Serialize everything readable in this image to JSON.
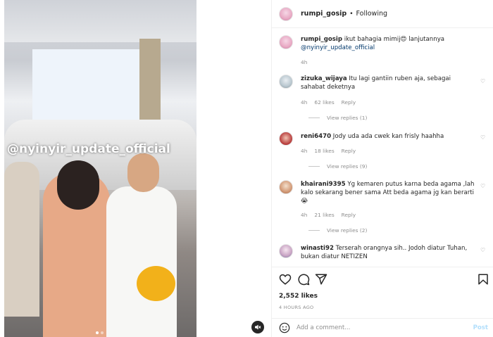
{
  "post": {
    "watermark": "@nyinyir_update_official"
  },
  "header": {
    "username": "rumpi_gosip",
    "separator": "•",
    "follow_label": "Following"
  },
  "caption": {
    "username": "rumpi_gosip",
    "text": "ikut bahagia mimij😍 lanjutannya",
    "mention": "@nyinyir_update_official",
    "time": "4h"
  },
  "comments": [
    {
      "username": "zizuka_wijaya",
      "text": "Itu lagi gantiin ruben aja, sebagai sahabat deketnya",
      "time": "4h",
      "likes": "62 likes",
      "reply": "Reply",
      "view_replies": "View replies (1)"
    },
    {
      "username": "reni6470",
      "text": "Jody uda ada cwek kan frisly haahha",
      "time": "4h",
      "likes": "18 likes",
      "reply": "Reply",
      "view_replies": "View replies (9)"
    },
    {
      "username": "khairani9395",
      "text": "Yg kemaren putus karna beda agama ,lah kalo sekarang bener sama Att beda agama jg kan berarti 😭",
      "time": "4h",
      "likes": "21 likes",
      "reply": "Reply",
      "view_replies": "View replies (2)"
    },
    {
      "username": "winasti92",
      "text": "Terserah orangnya sih.. Jodoh diatur Tuhan, bukan diatur NETIZEN",
      "time": "",
      "likes": "",
      "reply": "",
      "view_replies": ""
    }
  ],
  "stats": {
    "likes": "2,552 likes",
    "time_ago": "4 HOURS AGO"
  },
  "add_comment": {
    "placeholder": "Add a comment...",
    "post_label": "Post"
  },
  "icons": [
    "heart-icon",
    "comment-icon",
    "share-icon",
    "bookmark-icon",
    "emoji-icon",
    "mute-icon"
  ]
}
